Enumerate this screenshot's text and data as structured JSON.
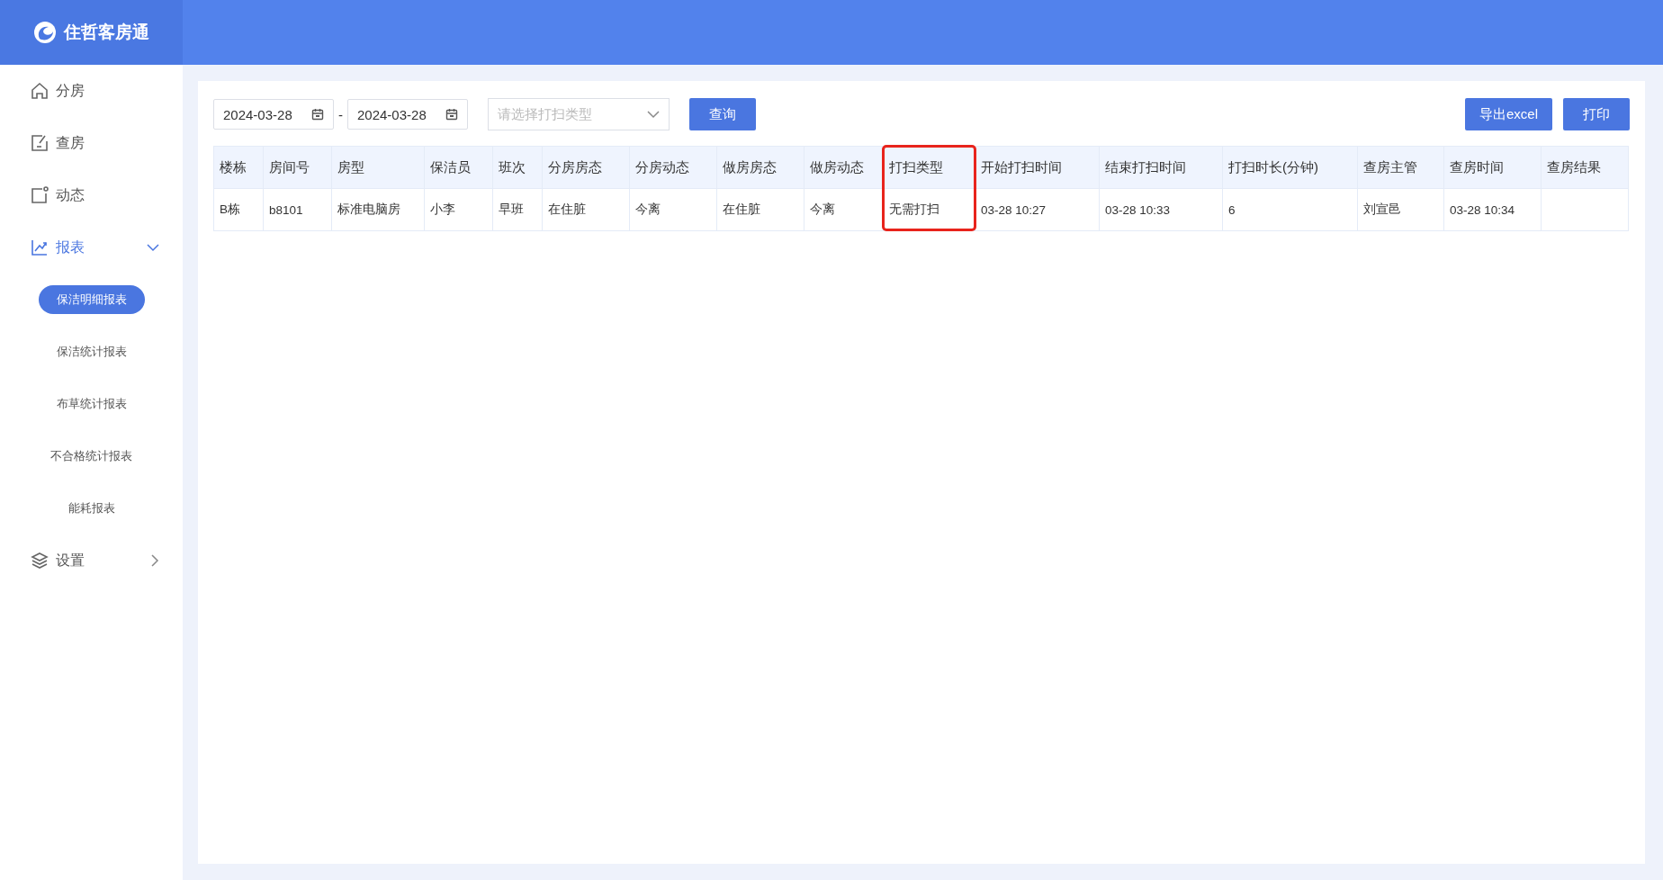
{
  "app": {
    "title": "住哲客房通"
  },
  "sidebar": {
    "items": [
      {
        "label": "分房",
        "selected": false
      },
      {
        "label": "查房",
        "selected": false
      },
      {
        "label": "动态",
        "selected": false
      },
      {
        "label": "报表",
        "selected": true,
        "expanded": true,
        "children": [
          {
            "label": "保洁明细报表",
            "selected": true
          },
          {
            "label": "保洁统计报表",
            "selected": false
          },
          {
            "label": "布草统计报表",
            "selected": false
          },
          {
            "label": "不合格统计报表",
            "selected": false
          },
          {
            "label": "能耗报表",
            "selected": false
          }
        ]
      },
      {
        "label": "设置",
        "selected": false,
        "expanded": false
      }
    ]
  },
  "filters": {
    "start_date": "2024-03-28",
    "separator": "-",
    "end_date": "2024-03-28",
    "type_select": {
      "placeholder": "请选择打扫类型"
    },
    "query_button": "查询",
    "export_button": "导出excel",
    "print_button": "打印"
  },
  "table": {
    "columns": [
      {
        "label": "楼栋",
        "highlighted": false
      },
      {
        "label": "房间号",
        "highlighted": false
      },
      {
        "label": "房型",
        "highlighted": false
      },
      {
        "label": "保洁员",
        "highlighted": false
      },
      {
        "label": "班次",
        "highlighted": false
      },
      {
        "label": "分房房态",
        "highlighted": false
      },
      {
        "label": "分房动态",
        "highlighted": false
      },
      {
        "label": "做房房态",
        "highlighted": false
      },
      {
        "label": "做房动态",
        "highlighted": false
      },
      {
        "label": "打扫类型",
        "highlighted": true
      },
      {
        "label": "开始打扫时间",
        "highlighted": false
      },
      {
        "label": "结束打扫时间",
        "highlighted": false
      },
      {
        "label": "打扫时长(分钟)",
        "highlighted": false
      },
      {
        "label": "查房主管",
        "highlighted": false
      },
      {
        "label": "查房时间",
        "highlighted": false
      },
      {
        "label": "查房结果",
        "highlighted": false
      }
    ],
    "rows": [
      [
        "B栋",
        "b8101",
        "标准电脑房",
        "小李",
        "早班",
        "在住脏",
        "今离",
        "在住脏",
        "今离",
        "无需打扫",
        "03-28 10:27",
        "03-28 10:33",
        "6",
        "刘宣邑",
        "03-28 10:34",
        ""
      ]
    ]
  }
}
